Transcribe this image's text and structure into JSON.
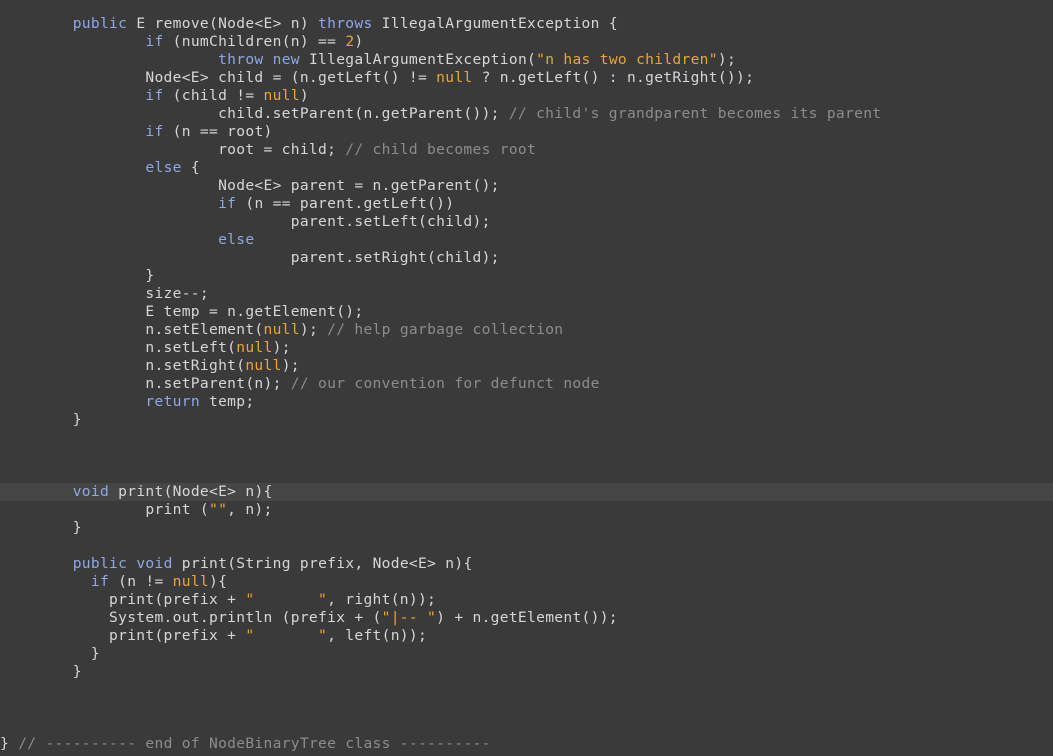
{
  "editor": {
    "lines": [
      [
        [
          "        ",
          "p"
        ],
        [
          "public",
          "k"
        ],
        [
          " E remove(Node<E> n) ",
          "p"
        ],
        [
          "throws",
          "k"
        ],
        [
          " IllegalArgumentException {",
          "p"
        ]
      ],
      [
        [
          "                ",
          "p"
        ],
        [
          "if",
          "k"
        ],
        [
          " (numChildren(n) == ",
          "p"
        ],
        [
          "2",
          "l"
        ],
        [
          ")",
          "p"
        ]
      ],
      [
        [
          "                        ",
          "p"
        ],
        [
          "throw",
          "k"
        ],
        [
          " ",
          "p"
        ],
        [
          "new",
          "k"
        ],
        [
          " IllegalArgumentException(",
          "p"
        ],
        [
          "\"n has two children\"",
          "s"
        ],
        [
          ");",
          "p"
        ]
      ],
      [
        [
          "                Node<E> child = (n.getLeft() != ",
          "p"
        ],
        [
          "null",
          "l"
        ],
        [
          " ? n.getLeft() : n.getRight());",
          "p"
        ]
      ],
      [
        [
          "                ",
          "p"
        ],
        [
          "if",
          "k"
        ],
        [
          " (child != ",
          "p"
        ],
        [
          "null",
          "l"
        ],
        [
          ")",
          "p"
        ]
      ],
      [
        [
          "                        child.setParent(n.getParent()); ",
          "p"
        ],
        [
          "// child's grandparent becomes its parent",
          "c"
        ]
      ],
      [
        [
          "                ",
          "p"
        ],
        [
          "if",
          "k"
        ],
        [
          " (n == root)",
          "p"
        ]
      ],
      [
        [
          "                        root = child; ",
          "p"
        ],
        [
          "// child becomes root",
          "c"
        ]
      ],
      [
        [
          "                ",
          "p"
        ],
        [
          "else",
          "k"
        ],
        [
          " {",
          "p"
        ]
      ],
      [
        [
          "                        Node<E> parent = n.getParent();",
          "p"
        ]
      ],
      [
        [
          "                        ",
          "p"
        ],
        [
          "if",
          "k"
        ],
        [
          " (n == parent.getLeft())",
          "p"
        ]
      ],
      [
        [
          "                                parent.setLeft(child);",
          "p"
        ]
      ],
      [
        [
          "                        ",
          "p"
        ],
        [
          "else",
          "k"
        ]
      ],
      [
        [
          "                                parent.setRight(child);",
          "p"
        ]
      ],
      [
        [
          "                }",
          "p"
        ]
      ],
      [
        [
          "                size--;",
          "p"
        ]
      ],
      [
        [
          "                E temp = n.getElement();",
          "p"
        ]
      ],
      [
        [
          "                n.setElement(",
          "p"
        ],
        [
          "null",
          "l"
        ],
        [
          "); ",
          "p"
        ],
        [
          "// help garbage collection",
          "c"
        ]
      ],
      [
        [
          "                n.setLeft(",
          "p"
        ],
        [
          "null",
          "l"
        ],
        [
          ");",
          "p"
        ]
      ],
      [
        [
          "                n.setRight(",
          "p"
        ],
        [
          "null",
          "l"
        ],
        [
          ");",
          "p"
        ]
      ],
      [
        [
          "                n.setParent(n); ",
          "p"
        ],
        [
          "// our convention for defunct node",
          "c"
        ]
      ],
      [
        [
          "                ",
          "p"
        ],
        [
          "return",
          "k"
        ],
        [
          " temp;",
          "p"
        ]
      ],
      [
        [
          "        }",
          "p"
        ]
      ],
      [],
      [],
      [],
      [
        [
          "        ",
          "p"
        ],
        [
          "void",
          "k"
        ],
        [
          " print(Node<E> n){",
          "p"
        ]
      ],
      [
        [
          "                print (",
          "p"
        ],
        [
          "\"\"",
          "s"
        ],
        [
          ", n);",
          "p"
        ]
      ],
      [
        [
          "        }",
          "p"
        ]
      ],
      [],
      [
        [
          "        ",
          "p"
        ],
        [
          "public",
          "k"
        ],
        [
          " ",
          "p"
        ],
        [
          "void",
          "k"
        ],
        [
          " print(String prefix, Node<E> n){",
          "p"
        ]
      ],
      [
        [
          "          ",
          "p"
        ],
        [
          "if",
          "k"
        ],
        [
          " (n != ",
          "p"
        ],
        [
          "null",
          "l"
        ],
        [
          "){",
          "p"
        ]
      ],
      [
        [
          "            print(prefix + ",
          "p"
        ],
        [
          "\"       \"",
          "s"
        ],
        [
          ", right(n));",
          "p"
        ]
      ],
      [
        [
          "            System.out.println (prefix + (",
          "p"
        ],
        [
          "\"|-- \"",
          "s"
        ],
        [
          ") + n.getElement());",
          "p"
        ]
      ],
      [
        [
          "            print(prefix + ",
          "p"
        ],
        [
          "\"       \"",
          "s"
        ],
        [
          ", left(n));",
          "p"
        ]
      ],
      [
        [
          "          }",
          "p"
        ]
      ],
      [
        [
          "        }",
          "p"
        ]
      ],
      [],
      [],
      [],
      [
        [
          "} ",
          "p"
        ],
        [
          "// ---------- end of NodeBinaryTree class ----------",
          "c"
        ]
      ]
    ]
  }
}
